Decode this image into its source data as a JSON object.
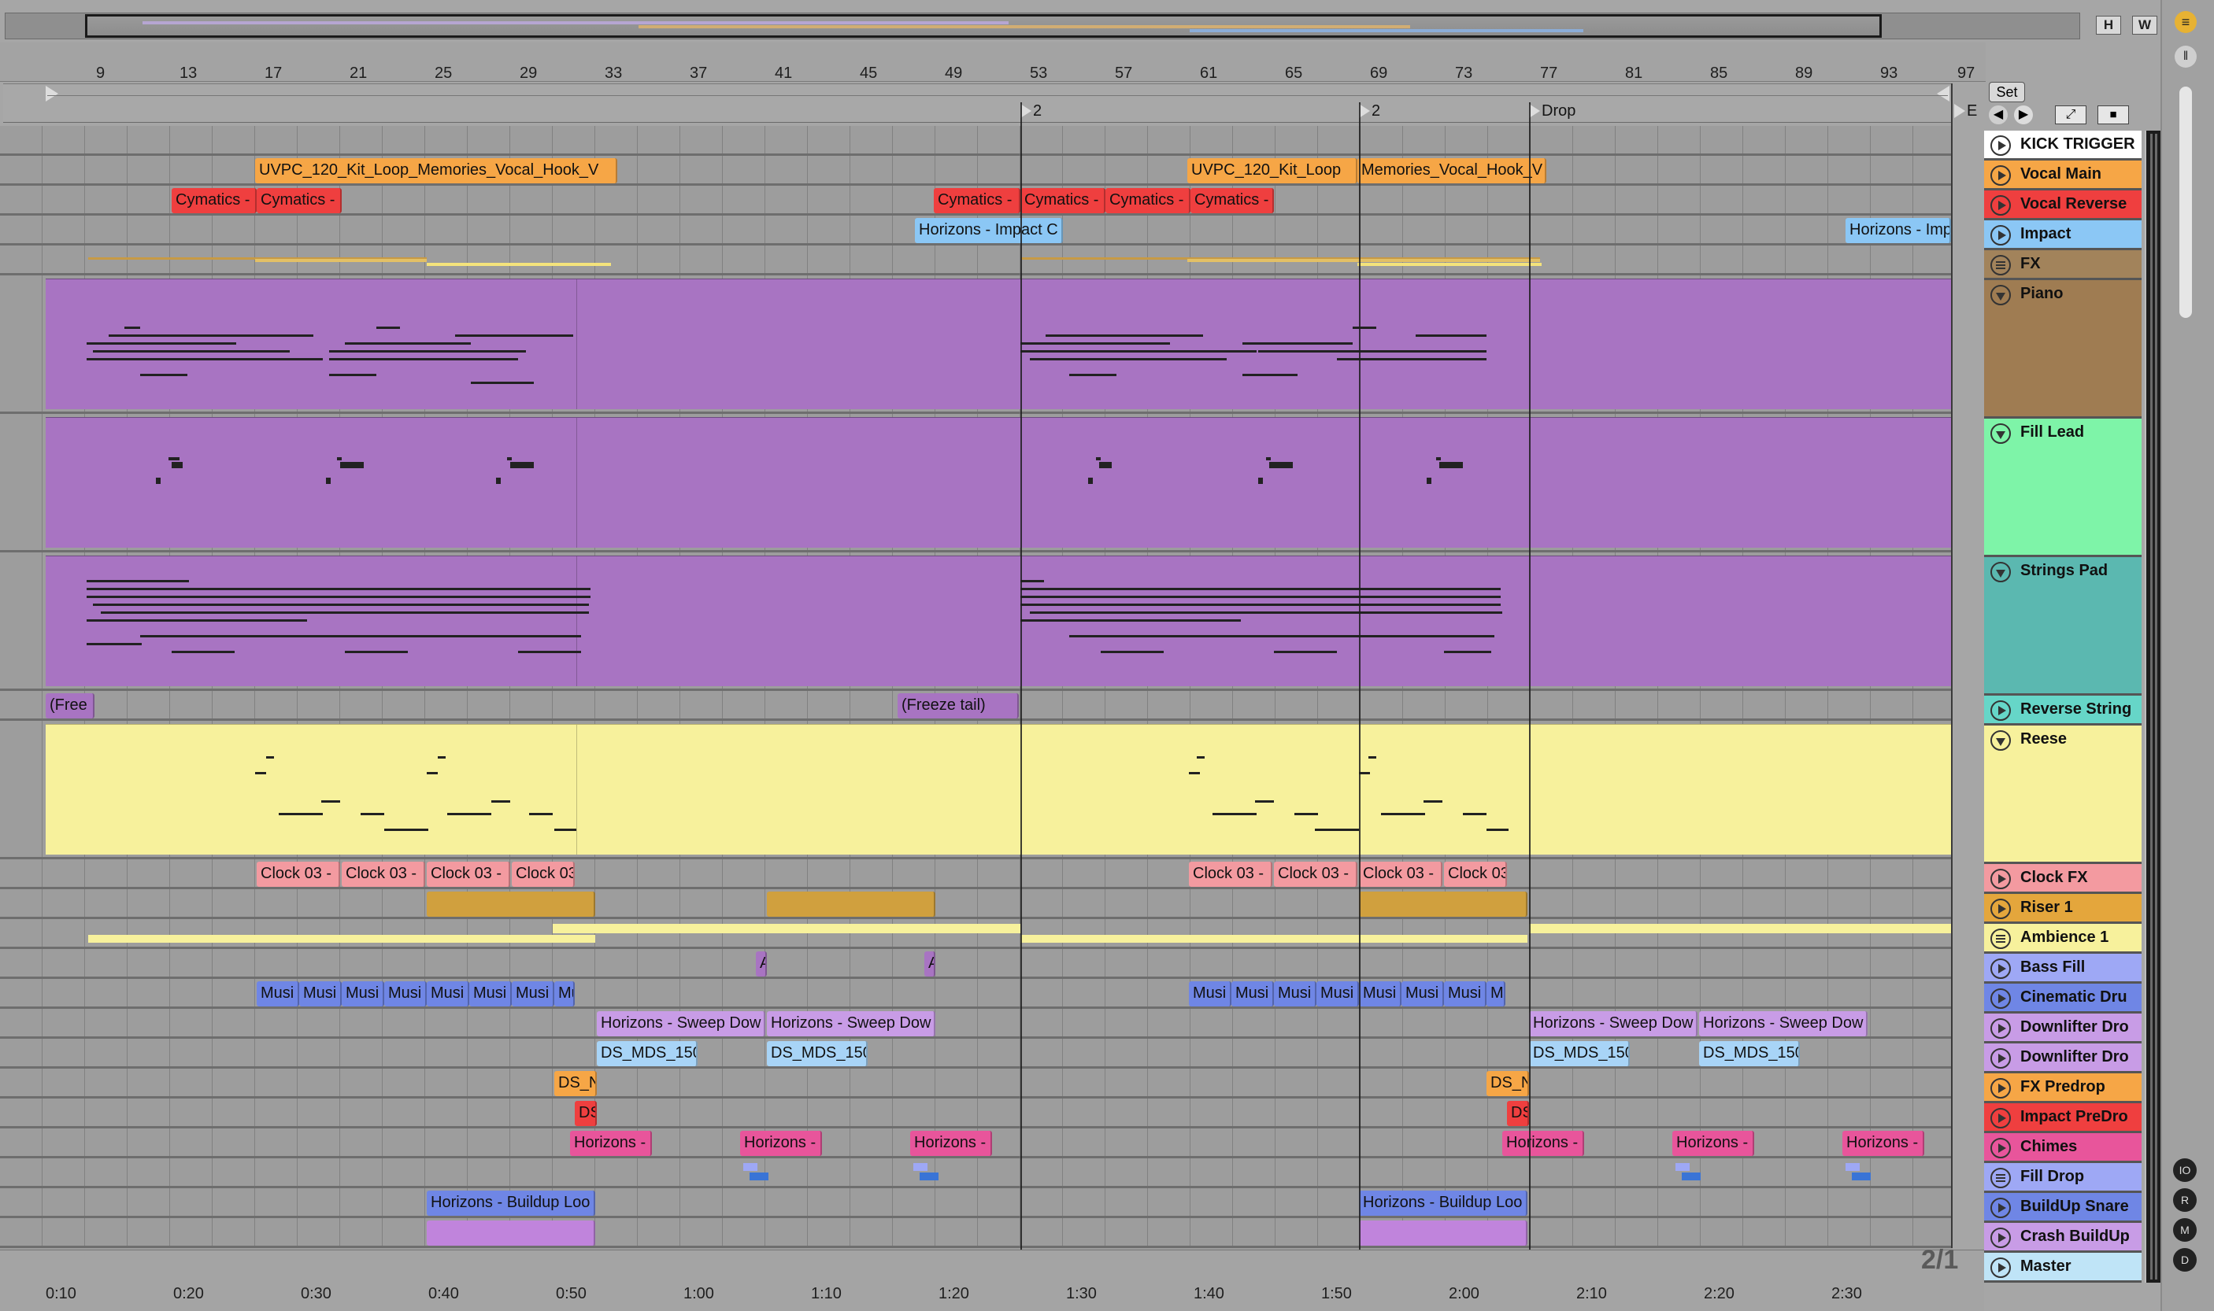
{
  "overview": {
    "toggles": [
      "H",
      "W"
    ]
  },
  "beat_ruler": {
    "numbers": [
      "9",
      "13",
      "17",
      "21",
      "25",
      "29",
      "33",
      "37",
      "41",
      "45",
      "49",
      "53",
      "57",
      "61",
      "65",
      "69",
      "73",
      "77",
      "81",
      "85",
      "89",
      "93",
      "97"
    ]
  },
  "locators": [
    {
      "label": "2"
    },
    {
      "label": "2"
    },
    {
      "label": "Drop"
    },
    {
      "label": "E"
    }
  ],
  "controls": {
    "set_label": "Set"
  },
  "time_ruler": {
    "labels": [
      "0:10",
      "0:20",
      "0:30",
      "0:40",
      "0:50",
      "1:00",
      "1:10",
      "1:20",
      "1:30",
      "1:40",
      "1:50",
      "2:00",
      "2:10",
      "2:20",
      "2:30"
    ]
  },
  "page_indicator": "2/1",
  "tracks": [
    {
      "name": "KICK TRIGGER",
      "color": "#ffffff",
      "type": "play"
    },
    {
      "name": "Vocal Main",
      "color": "#f6a646",
      "type": "play"
    },
    {
      "name": "Vocal Reverse",
      "color": "#ef3f3f",
      "type": "play"
    },
    {
      "name": "Impact",
      "color": "#8bc7f5",
      "type": "play"
    },
    {
      "name": "FX",
      "color": "#a2835b",
      "type": "group"
    },
    {
      "name": "Piano",
      "color": "#9f7c52",
      "type": "fold"
    },
    {
      "name": "Fill Lead",
      "color": "#7ef4a8",
      "type": "fold"
    },
    {
      "name": "Strings Pad",
      "color": "#5bb8b0",
      "type": "fold"
    },
    {
      "name": "Reverse String",
      "color": "#66d6c8",
      "type": "play"
    },
    {
      "name": "Reese",
      "color": "#f7f19c",
      "type": "fold"
    },
    {
      "name": "Clock FX",
      "color": "#f39aa0",
      "type": "play"
    },
    {
      "name": "Riser 1",
      "color": "#e4a63c",
      "type": "play"
    },
    {
      "name": "Ambience 1",
      "color": "#f7f19c",
      "type": "group"
    },
    {
      "name": "Bass Fill",
      "color": "#9ea8f5",
      "type": "play"
    },
    {
      "name": "Cinematic Dru",
      "color": "#6f86e5",
      "type": "play"
    },
    {
      "name": "Downlifter Dro",
      "color": "#c89ce6",
      "type": "play"
    },
    {
      "name": "Downlifter Dro",
      "color": "#c89ce6",
      "type": "play"
    },
    {
      "name": "FX Predrop",
      "color": "#f6a646",
      "type": "play"
    },
    {
      "name": "Impact PreDro",
      "color": "#ef3f3f",
      "type": "play"
    },
    {
      "name": "Chimes",
      "color": "#e8559b",
      "type": "play"
    },
    {
      "name": "Fill Drop",
      "color": "#9ea8f5",
      "type": "group"
    },
    {
      "name": "BuildUp Snare",
      "color": "#6f86e5",
      "type": "play"
    },
    {
      "name": "Crash BuildUp",
      "color": "#c89ce6",
      "type": "play"
    },
    {
      "name": "Master",
      "color": "#bfe4f7",
      "type": "play"
    }
  ],
  "clips": {
    "vocal_main": [
      "UVPC_120_Kit_Loop_Memories_Vocal_Hook_V",
      "UVPC_120_Kit_Loop",
      "Memories_Vocal_Hook_V"
    ],
    "vocal_reverse": [
      "Cymatics -",
      "Cymatics -",
      "Cymatics -",
      "Cymatics -",
      "Cymatics -",
      "Cymatics -"
    ],
    "impact": [
      "Horizons - Impact C",
      "Horizons - Impact"
    ],
    "reverse_string": [
      "(Free",
      "(Freeze tail)"
    ],
    "clock_fx": [
      "Clock 03 -",
      "Clock 03 -",
      "Clock 03 -",
      "Clock 03",
      "Clock 03 -",
      "Clock 03 -",
      "Clock 03 -",
      "Clock 03"
    ],
    "bass_fill": [
      "A",
      "A"
    ],
    "cinematic": [
      "Musi",
      "Musi",
      "Musi",
      "Musi",
      "Musi",
      "Musi",
      "Musi",
      "Mu",
      "Musi",
      "Musi",
      "Musi",
      "Musi",
      "Musi",
      "Musi",
      "Musi",
      "M"
    ],
    "downlifter1": [
      "Horizons - Sweep Dow",
      "Horizons - Sweep Dow",
      "Horizons - Sweep Dow",
      "Horizons - Sweep Dow"
    ],
    "downlifter2": [
      "DS_MDS_150",
      "DS_MDS_150",
      "DS_MDS_150",
      "DS_MDS_150"
    ],
    "fx_predrop": [
      "DS_N",
      "DS_N"
    ],
    "impact_predrop": [
      "DS",
      "DS"
    ],
    "chimes": [
      "Horizons -",
      "Horizons -",
      "Horizons -",
      "Horizons -",
      "Horizons -",
      "Horizons -"
    ],
    "buildup_snare": [
      "Horizons - Buildup Loo",
      "Horizons - Buildup Loo"
    ]
  }
}
